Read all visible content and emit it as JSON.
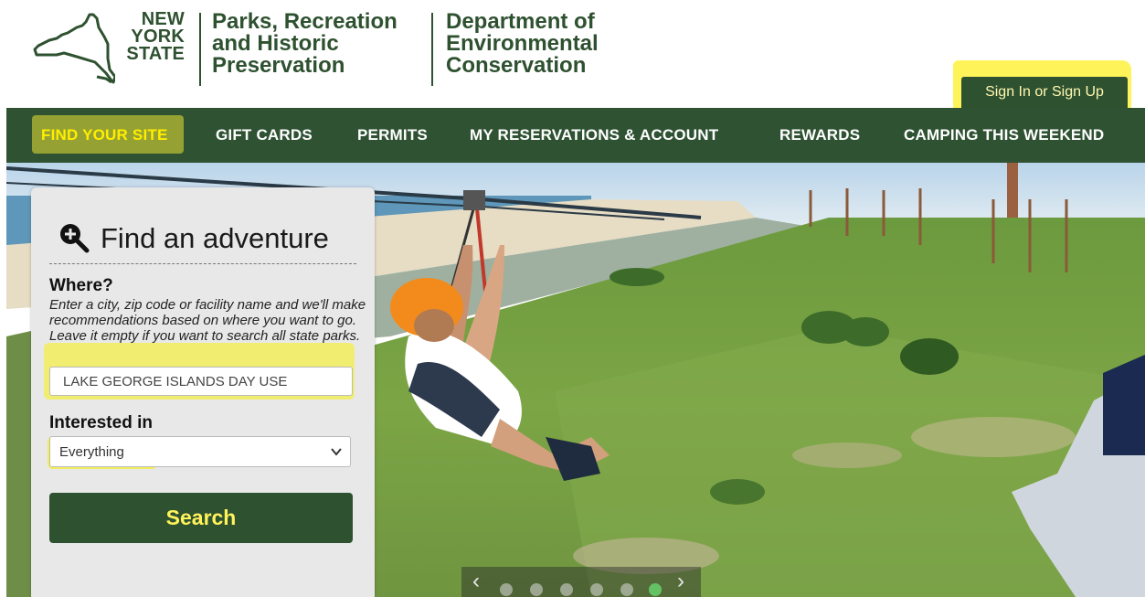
{
  "header": {
    "state_logo_lines": [
      "NEW",
      "YORK",
      "STATE"
    ],
    "org1_lines": [
      "Parks, Recreation",
      "and Historic",
      "Preservation"
    ],
    "org2_lines": [
      "Department of",
      "Environmental",
      "Conservation"
    ],
    "signin_label": "Sign In or Sign Up"
  },
  "nav": {
    "items": [
      {
        "label": "FIND YOUR SITE",
        "active": true
      },
      {
        "label": "GIFT CARDS",
        "active": false
      },
      {
        "label": "PERMITS",
        "active": false
      },
      {
        "label": "MY RESERVATIONS & ACCOUNT",
        "active": false
      },
      {
        "label": "REWARDS",
        "active": false
      },
      {
        "label": "CAMPING THIS WEEKEND",
        "active": false
      }
    ]
  },
  "search": {
    "title": "Find an adventure",
    "title_icon": "magnifier-plus-icon",
    "where_label": "Where?",
    "where_help": "Enter a city, zip code or facility name and we'll make recommendations based on where you want to go. Leave it empty if you want to search all state parks.",
    "location_value": "LAKE GEORGE ISLANDS DAY USE",
    "interest_label": "Interested in",
    "interest_value": "Everything",
    "search_label": "Search"
  },
  "carousel": {
    "prev": "‹",
    "next": "›",
    "slide_count": 6,
    "active_slide": 6
  },
  "colors": {
    "brand_green": "#2e5130",
    "highlight_yellow": "#f6f020",
    "active_nav": "#ffee00"
  }
}
